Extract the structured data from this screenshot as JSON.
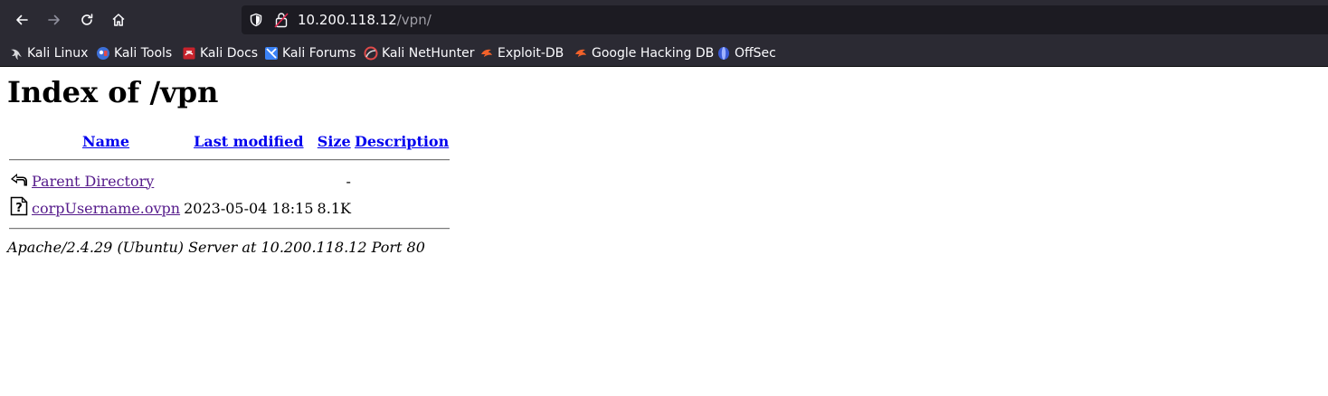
{
  "browser": {
    "url_host": "10.200.118.12",
    "url_path": "/vpn/",
    "bookmarks": [
      {
        "label": "Kali Linux",
        "icon": "kali-dragon-icon"
      },
      {
        "label": "Kali Tools",
        "icon": "kali-tools-icon"
      },
      {
        "label": "Kali Docs",
        "icon": "kali-docs-icon"
      },
      {
        "label": "Kali Forums",
        "icon": "kali-forums-icon"
      },
      {
        "label": "Kali NetHunter",
        "icon": "kali-nethunter-icon"
      },
      {
        "label": "Exploit-DB",
        "icon": "exploit-db-icon"
      },
      {
        "label": "Google Hacking DB",
        "icon": "ghdb-icon"
      },
      {
        "label": "OffSec",
        "icon": "offsec-icon"
      }
    ]
  },
  "page": {
    "title": "Index of /vpn",
    "columns": {
      "name": "Name",
      "last_modified": "Last modified",
      "size": "Size",
      "description": "Description"
    },
    "rows": [
      {
        "icon": "back-icon",
        "name": "Parent Directory",
        "last_modified": "",
        "size": "-",
        "description": ""
      },
      {
        "icon": "unknown-file-icon",
        "name": "corpUsername.ovpn",
        "last_modified": "2023-05-04 18:15",
        "size": "8.1K",
        "description": ""
      }
    ],
    "server_signature": "Apache/2.4.29 (Ubuntu) Server at 10.200.118.12 Port 80"
  },
  "colors": {
    "chrome_bg": "#2b2a33",
    "urlbar_bg": "#1c1b22",
    "link": "#0000ee",
    "visited_link": "#551a8b"
  }
}
